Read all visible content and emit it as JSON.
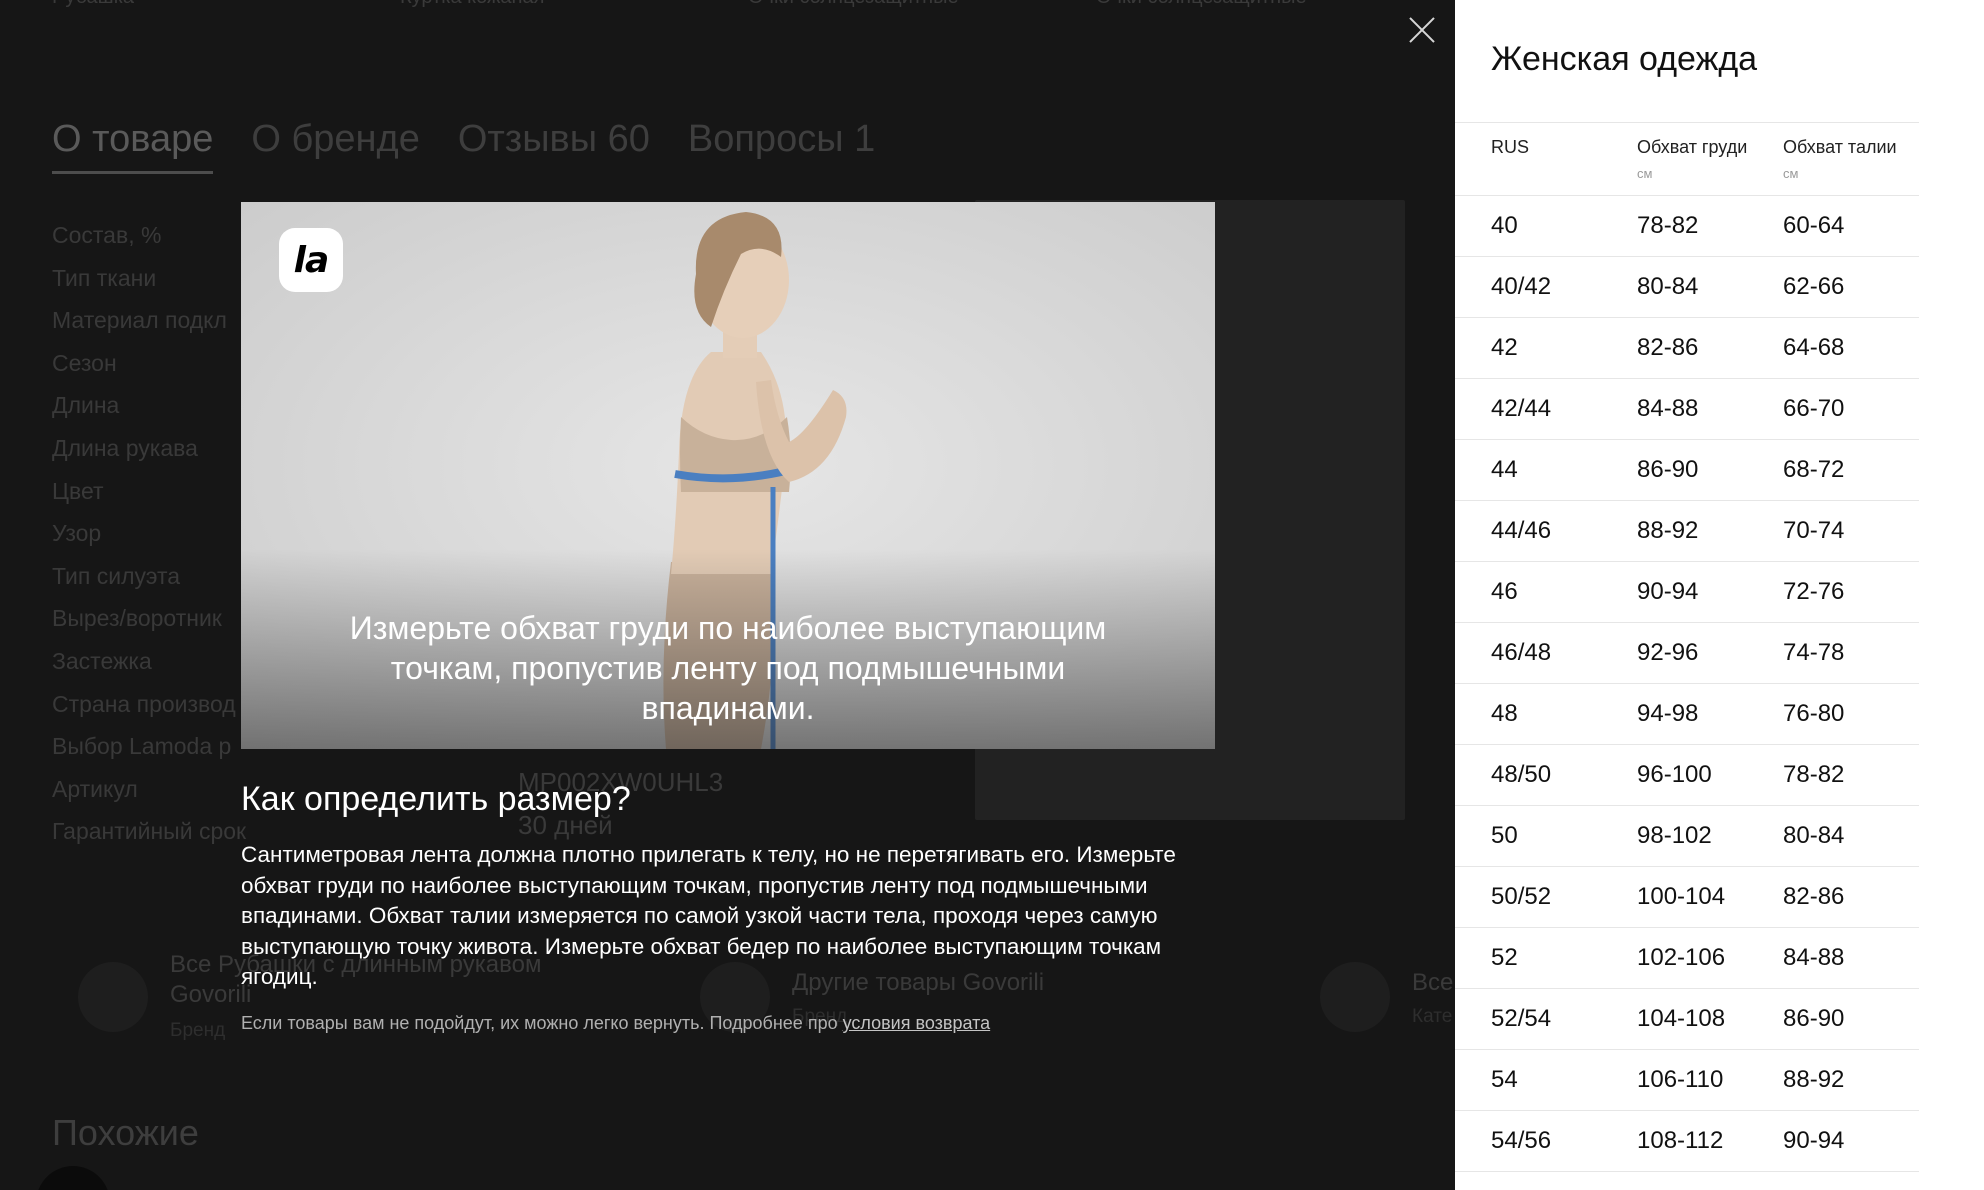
{
  "background": {
    "top_items": [
      "Рубашка",
      "Куртка кожаная",
      "Очки солнцезащитные",
      "Очки солнцезащитные"
    ],
    "tabs": [
      "О товаре",
      "О бренде",
      "Отзывы 60",
      "Вопросы 1"
    ],
    "properties": [
      "Состав, %",
      "Тип ткани",
      "Материал подкл",
      "Сезон",
      "Длина",
      "Длина рукава",
      "Цвет",
      "Узор",
      "Тип силуэта",
      "Вырез/воротник",
      "Застежка",
      "Страна производ",
      "Выбор Lamoda p",
      "Артикул",
      "Гарантийный срок"
    ],
    "article_value": "MP002XW0UHL3",
    "warranty_value": "30 дней",
    "cards": [
      {
        "title": "Все Рубашки с длинным рукавом Govorili",
        "sub": "Бренд"
      },
      {
        "title": "Другие товары Govorili",
        "sub": "Бренд"
      },
      {
        "title": "Все",
        "sub": "Кате"
      }
    ],
    "similar_title": "Похожие"
  },
  "modal": {
    "badge": "la",
    "caption": "Измерьте обхват груди по наиболее выступающим точкам, пропустив ленту под подмышечными впадинами.",
    "title": "Как определить размер?",
    "body": "Сантиметровая лента должна плотно прилегать к телу, но не перетягивать его. Измерьте обхват груди по наиболее выступающим точкам, пропустив ленту под подмышечными впадинами. Обхват талии измеряется по самой узкой части тела, проходя через самую выступающую точку живота. Измерьте обхват бедер по наиболее выступающим точкам ягодиц.",
    "footer_text": "Если товары вам не подойдут, их можно легко вернуть. Подробнее про",
    "footer_link": "условия возврата"
  },
  "size_panel": {
    "title": "Женская одежда",
    "columns": [
      {
        "label": "RUS",
        "unit": ""
      },
      {
        "label": "Обхват груди",
        "unit": "см"
      },
      {
        "label": "Обхват талии",
        "unit": "см"
      }
    ],
    "rows": [
      [
        "40",
        "78-82",
        "60-64"
      ],
      [
        "40/42",
        "80-84",
        "62-66"
      ],
      [
        "42",
        "82-86",
        "64-68"
      ],
      [
        "42/44",
        "84-88",
        "66-70"
      ],
      [
        "44",
        "86-90",
        "68-72"
      ],
      [
        "44/46",
        "88-92",
        "70-74"
      ],
      [
        "46",
        "90-94",
        "72-76"
      ],
      [
        "46/48",
        "92-96",
        "74-78"
      ],
      [
        "48",
        "94-98",
        "76-80"
      ],
      [
        "48/50",
        "96-100",
        "78-82"
      ],
      [
        "50",
        "98-102",
        "80-84"
      ],
      [
        "50/52",
        "100-104",
        "82-86"
      ],
      [
        "52",
        "102-106",
        "84-88"
      ],
      [
        "52/54",
        "104-108",
        "86-90"
      ],
      [
        "54",
        "106-110",
        "88-92"
      ],
      [
        "54/56",
        "108-112",
        "90-94"
      ]
    ]
  },
  "colors": {
    "overlay": "#161616",
    "panel_bg": "#ffffff",
    "tape": "#4a7fc1"
  }
}
